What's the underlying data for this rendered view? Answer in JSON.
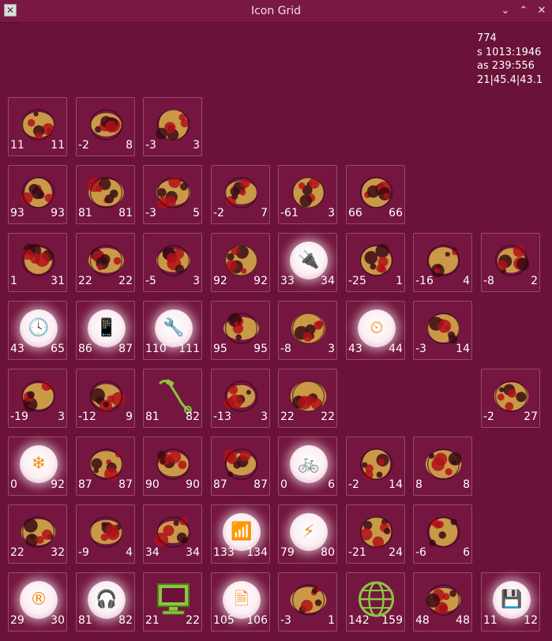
{
  "window": {
    "title": "Icon Grid",
    "app_icon": "x-app-icon",
    "controls": [
      "minimize",
      "maximize",
      "close"
    ]
  },
  "stats": [
    "774",
    "s 1013:1946",
    "as 239:556",
    "21|45.4|43.1"
  ],
  "colors": {
    "background": "#6a1238",
    "titlebar": "#7a1844",
    "cell_border": "#9a4a6c",
    "orb_glyph": "#f08a1c",
    "texture_gold": "#d9b04a",
    "texture_red": "#b0101a"
  },
  "grid": [
    [
      {
        "icon": "paw-icon",
        "style": "texture",
        "left": "11",
        "right": "11"
      },
      {
        "icon": "butterfly-icon",
        "style": "texture",
        "left": "-2",
        "right": "8"
      },
      {
        "icon": "treble-clef-icon",
        "style": "texture",
        "left": "-3",
        "right": "3"
      }
    ],
    [
      {
        "icon": "hand-icon",
        "style": "texture",
        "left": "93",
        "right": "93"
      },
      {
        "icon": "circle-icon",
        "style": "texture",
        "left": "81",
        "right": "81"
      },
      {
        "icon": "horns-icon",
        "style": "texture",
        "left": "-3",
        "right": "5"
      },
      {
        "icon": "elephant-icon",
        "style": "texture",
        "left": "-2",
        "right": "7"
      },
      {
        "icon": "info-icon",
        "style": "texture",
        "left": "-61",
        "right": "3"
      },
      {
        "icon": "ladder-icon",
        "style": "texture",
        "left": "66",
        "right": "66"
      }
    ],
    [
      {
        "icon": "ship-icon",
        "style": "texture",
        "left": "1",
        "right": "31"
      },
      {
        "icon": "anchor-icon",
        "style": "texture",
        "left": "22",
        "right": "22"
      },
      {
        "icon": "sneaker-icon",
        "style": "texture",
        "left": "-5",
        "right": "3"
      },
      {
        "icon": "fishbowl-icon",
        "style": "texture",
        "left": "92",
        "right": "92"
      },
      {
        "icon": "plug-icon",
        "style": "orb",
        "glyph": "🔌",
        "left": "33",
        "right": "34"
      },
      {
        "icon": "baby-face-icon",
        "style": "texture",
        "left": "-25",
        "right": "1"
      },
      {
        "icon": "disc-icon",
        "style": "texture",
        "left": "-16",
        "right": "4"
      },
      {
        "icon": "heart-lock-icon",
        "style": "texture",
        "left": "-8",
        "right": "2"
      }
    ],
    [
      {
        "icon": "clock-icon",
        "style": "orb",
        "glyph": "🕓",
        "left": "43",
        "right": "65"
      },
      {
        "icon": "phone-icon",
        "style": "orb",
        "glyph": "📱",
        "left": "86",
        "right": "87"
      },
      {
        "icon": "tools-icon",
        "style": "orb",
        "glyph": "🔧",
        "left": "110",
        "right": "111"
      },
      {
        "icon": "microscope-icon",
        "style": "texture",
        "left": "95",
        "right": "95"
      },
      {
        "icon": "drop-icon",
        "style": "texture",
        "left": "-8",
        "right": "3"
      },
      {
        "icon": "speedometer-icon",
        "style": "orb",
        "glyph": "⏲",
        "left": "43",
        "right": "44"
      },
      {
        "icon": "diver-icon",
        "style": "texture",
        "left": "-3",
        "right": "14"
      }
    ],
    [
      {
        "icon": "trumpet-icon",
        "style": "texture",
        "left": "-19",
        "right": "3"
      },
      {
        "icon": "tuba-icon",
        "style": "texture",
        "left": "-12",
        "right": "9"
      },
      {
        "icon": "jump-rope-icon",
        "style": "green",
        "left": "81",
        "right": "82"
      },
      {
        "icon": "superman-icon",
        "style": "texture",
        "left": "-13",
        "right": "3"
      },
      {
        "icon": "arrows-icon",
        "style": "texture",
        "left": "22",
        "right": "22"
      },
      {
        "icon": "clipboard-icon",
        "style": "texture",
        "left": "-2",
        "right": "27",
        "col": 7
      }
    ],
    [
      {
        "icon": "snowflake-icon",
        "style": "orb",
        "glyph": "❄",
        "left": "0",
        "right": "92"
      },
      {
        "icon": "duck-icon",
        "style": "texture",
        "left": "87",
        "right": "87"
      },
      {
        "icon": "rabbit-icon",
        "style": "texture",
        "left": "90",
        "right": "90"
      },
      {
        "icon": "dragon-icon",
        "style": "texture",
        "left": "87",
        "right": "87"
      },
      {
        "icon": "bicycle-icon",
        "style": "orb",
        "glyph": "🚲",
        "left": "0",
        "right": "6"
      },
      {
        "icon": "monkey-icon",
        "style": "texture",
        "left": "-2",
        "right": "14"
      },
      {
        "icon": "fish-icon",
        "style": "texture",
        "left": "8",
        "right": "8"
      }
    ],
    [
      {
        "icon": "keyboard-icon",
        "style": "texture",
        "left": "22",
        "right": "32"
      },
      {
        "icon": "map-icon",
        "style": "texture",
        "left": "-9",
        "right": "4"
      },
      {
        "icon": "hammock-icon",
        "style": "texture",
        "left": "34",
        "right": "34"
      },
      {
        "icon": "broadcast-icon",
        "style": "orb",
        "glyph": "📶",
        "left": "133",
        "right": "134"
      },
      {
        "icon": "magic-wand-icon",
        "style": "orb",
        "glyph": "⚡",
        "left": "79",
        "right": "80"
      },
      {
        "icon": "paperclip-icon",
        "style": "texture",
        "left": "-21",
        "right": "24"
      },
      {
        "icon": "people-icon",
        "style": "texture",
        "left": "-6",
        "right": "6"
      }
    ],
    [
      {
        "icon": "registered-icon",
        "style": "orb",
        "glyph": "®",
        "left": "29",
        "right": "30"
      },
      {
        "icon": "headphones-icon",
        "style": "orb",
        "glyph": "🎧",
        "left": "81",
        "right": "82"
      },
      {
        "icon": "monitor-icon",
        "style": "green",
        "left": "21",
        "right": "22"
      },
      {
        "icon": "document-icon",
        "style": "orb",
        "glyph": "🗎",
        "left": "105",
        "right": "106"
      },
      {
        "icon": "chart-icon",
        "style": "texture",
        "left": "-3",
        "right": "1"
      },
      {
        "icon": "globe-icon",
        "style": "green",
        "left": "142",
        "right": "159"
      },
      {
        "icon": "music-note-icon",
        "style": "texture",
        "left": "48",
        "right": "48"
      },
      {
        "icon": "floppy-icon",
        "style": "orb",
        "glyph": "💾",
        "left": "11",
        "right": "12"
      }
    ]
  ]
}
